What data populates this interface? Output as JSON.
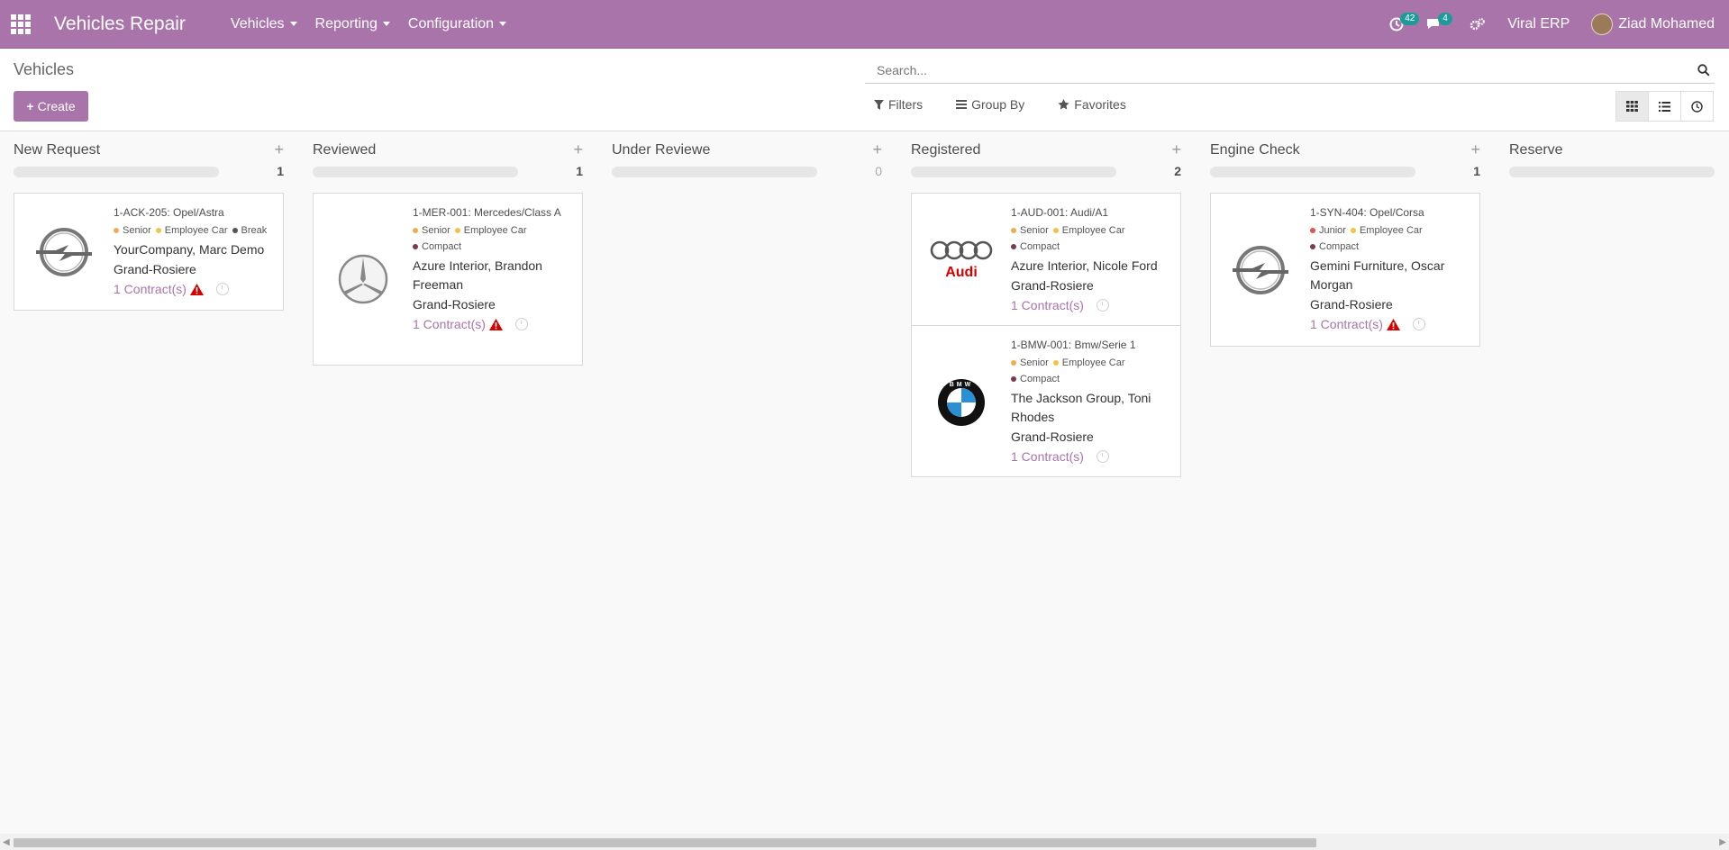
{
  "nav": {
    "app_title": "Vehicles Repair",
    "menu": [
      "Vehicles",
      "Reporting",
      "Configuration"
    ],
    "activity_count": "42",
    "message_count": "4",
    "company": "Viral ERP",
    "user": "Ziad Mohamed"
  },
  "control": {
    "breadcrumb": "Vehicles",
    "create_label": "Create",
    "search_placeholder": "Search...",
    "filters_label": "Filters",
    "groupby_label": "Group By",
    "favorites_label": "Favorites"
  },
  "columns": [
    {
      "title": "New Request",
      "count": "1"
    },
    {
      "title": "Reviewed",
      "count": "1"
    },
    {
      "title": "Under Reviewe",
      "count": "0"
    },
    {
      "title": "Registered",
      "count": "2"
    },
    {
      "title": "Engine Check",
      "count": "1"
    },
    {
      "title": "Reserve",
      "count": ""
    }
  ],
  "cards": {
    "c1": {
      "ref": "1-ACK-205: Opel/Astra",
      "tags": [
        "Senior",
        "Employee Car",
        "Break"
      ],
      "name": "YourCompany, Marc Demo",
      "city": "Grand-Rosiere",
      "contracts": "1 Contract(s)"
    },
    "c2": {
      "ref": "1-MER-001: Mercedes/Class A",
      "tags": [
        "Senior",
        "Employee Car",
        "Compact"
      ],
      "name": "Azure Interior, Brandon Freeman",
      "city": "Grand-Rosiere",
      "contracts": "1 Contract(s)"
    },
    "c3": {
      "ref": "1-AUD-001: Audi/A1",
      "tags": [
        "Senior",
        "Employee Car",
        "Compact"
      ],
      "name": "Azure Interior, Nicole Ford",
      "city": "Grand-Rosiere",
      "contracts": "1 Contract(s)",
      "logo_text": "Audi"
    },
    "c4": {
      "ref": "1-BMW-001: Bmw/Serie 1",
      "tags": [
        "Senior",
        "Employee Car",
        "Compact"
      ],
      "name": "The Jackson Group, Toni Rhodes",
      "city": "Grand-Rosiere",
      "contracts": "1 Contract(s)",
      "logo_text": "BMW"
    },
    "c5": {
      "ref": "1-SYN-404: Opel/Corsa",
      "tags": [
        "Junior",
        "Employee Car",
        "Compact"
      ],
      "name": "Gemini Furniture, Oscar Morgan",
      "city": "Grand-Rosiere",
      "contracts": "1 Contract(s)"
    }
  },
  "colors": {
    "brand": "#a974aa",
    "warning": "#d40000",
    "tag_senior": "#f0ad4e",
    "tag_employee": "#f5c242",
    "tag_break": "#555555",
    "tag_compact": "#7a3b4e",
    "tag_junior": "#e0544c"
  }
}
